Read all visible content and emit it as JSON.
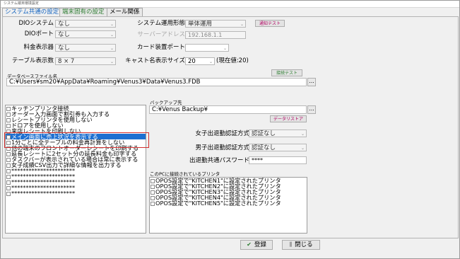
{
  "window": {
    "title": "システム端末環境設定"
  },
  "tabs": [
    {
      "label": "システム共通の設定"
    },
    {
      "label": "端末固有の設定"
    },
    {
      "label": "メール関係"
    }
  ],
  "fields": {
    "dio_system": {
      "label": "DIOシステム",
      "value": "なし"
    },
    "dio_port": {
      "label": "DIOポート",
      "value": "なし"
    },
    "fee_display": {
      "label": "料金表示器",
      "value": "なし"
    },
    "table_count": {
      "label": "テーブル表示数",
      "value": "8 × 7"
    },
    "system_mode": {
      "label": "システム運用形態",
      "value": "単体運用"
    },
    "server_address": {
      "label": "サーバーアドレス",
      "value": "192.168.1.1"
    },
    "card_port": {
      "label": "カード装置ポート",
      "value": ""
    },
    "cast_size": {
      "label": "キャスト名表示サイズ",
      "value": "20",
      "note": "(現在値:20)"
    },
    "db_file": {
      "label": "データベースファイル名",
      "value": "C:¥Users¥sm20¥AppData¥Roaming¥Venus3¥Data¥Venus3.FDB"
    },
    "backup": {
      "label": "バックアップ先",
      "value": "C:¥Venus Backup¥"
    },
    "female_auth": {
      "label": "女子出退勤認証方式",
      "value": "認証なし"
    },
    "male_auth": {
      "label": "男子出退勤認証方式",
      "value": "認証なし"
    },
    "common_password": {
      "label": "出退勤共通パスワード",
      "value": "****"
    },
    "printers_label": "このPCに接続されているプリンタ"
  },
  "buttons": {
    "notify_test": "通知テスト",
    "connect_test": "接続テスト",
    "data_restore": "データリストア",
    "browse": "...",
    "register": "登録",
    "close": "閉じる"
  },
  "options": [
    "キッチンプリンタ接続",
    "オーダー入力画面で割引券も入力する",
    "レシートプリンタを使用しない",
    "ドロアを使用しない",
    "来店レシートを印刷しない",
    "メイン画面に売上状況を表示する",
    "1分ごとに全テーブルの料金再計算をしない",
    "他の端末のフロントオーダーレシートを印刷する",
    "延長レシートに2セット分の延長料金も印字する",
    "タスクバーが表示されている場合は常に表示する",
    "女子成績CSV出力で詳細な情報を出力する",
    "**********************",
    "**********************",
    "**********************",
    "**********************",
    "**********************"
  ],
  "selected_option_index": 5,
  "printers": [
    "OPOS設定で\"KITCHEN1\"に設定されたプリンタ",
    "OPOS設定で\"KITCHEN2\"に設定されたプリンタ",
    "OPOS設定で\"KITCHEN3\"に設定されたプリンタ",
    "OPOS設定で\"KITCHEN4\"に設定されたプリンタ",
    "OPOS設定で\"KITCHEN5\"に設定されたプリンタ"
  ]
}
